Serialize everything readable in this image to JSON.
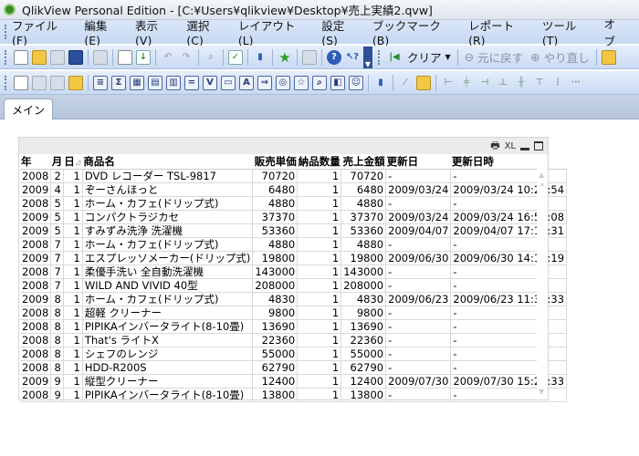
{
  "window": {
    "title": "QlikView Personal Edition - [C:¥Users¥qlikview¥Desktop¥売上実績2.qvw]"
  },
  "menu": [
    "ファイル(F)",
    "編集(E)",
    "表示(V)",
    "選択(C)",
    "レイアウト(L)",
    "設定(S)",
    "ブックマーク(B)",
    "レポート(R)",
    "ツール(T)",
    "オブ"
  ],
  "toolbar": {
    "clear": "クリア",
    "back": "元に戻す",
    "forward": "やり直し"
  },
  "tabs": [
    {
      "label": "メイン",
      "active": true
    }
  ],
  "table": {
    "caption_icons": {
      "print": "print-icon",
      "excel": "XL"
    },
    "headers": [
      "年",
      "月",
      "日",
      "商品名",
      "販売単価",
      "納品数量",
      "売上金額",
      "更新日",
      "更新日時"
    ],
    "sort_indicator": "日",
    "rows": [
      [
        "2008",
        "2",
        "1",
        "DVD レコーダー TSL-9817",
        "70720",
        "1",
        "70720",
        "-",
        "-"
      ],
      [
        "2009",
        "4",
        "1",
        "ぞーさんほっと",
        "6480",
        "1",
        "6480",
        "2009/03/24",
        "2009/03/24 10:24:54"
      ],
      [
        "2008",
        "5",
        "1",
        "ホーム・カフェ(ドリップ式)",
        "4880",
        "1",
        "4880",
        "-",
        "-"
      ],
      [
        "2009",
        "5",
        "1",
        "コンパクトラジカセ",
        "37370",
        "1",
        "37370",
        "2009/03/24",
        "2009/03/24 16:56:08"
      ],
      [
        "2009",
        "5",
        "1",
        "すみずみ洗浄 洗濯機",
        "53360",
        "1",
        "53360",
        "2009/04/07",
        "2009/04/07 17:10:31"
      ],
      [
        "2008",
        "7",
        "1",
        "ホーム・カフェ(ドリップ式)",
        "4880",
        "1",
        "4880",
        "-",
        "-"
      ],
      [
        "2009",
        "7",
        "1",
        "エスプレッソメーカー(ドリップ式)",
        "19800",
        "1",
        "19800",
        "2009/06/30",
        "2009/06/30 14:14:19"
      ],
      [
        "2008",
        "7",
        "1",
        "柔優手洗い 全自動洗濯機",
        "143000",
        "1",
        "143000",
        "-",
        "-"
      ],
      [
        "2008",
        "7",
        "1",
        "WILD AND VIVID 40型",
        "208000",
        "1",
        "208000",
        "-",
        "-"
      ],
      [
        "2009",
        "8",
        "1",
        "ホーム・カフェ(ドリップ式)",
        "4830",
        "1",
        "4830",
        "2009/06/23",
        "2009/06/23 11:33:33"
      ],
      [
        "2008",
        "8",
        "1",
        "超軽 クリーナー",
        "9800",
        "1",
        "9800",
        "-",
        "-"
      ],
      [
        "2008",
        "8",
        "1",
        "PIPIKAインバータライト(8-10畳)",
        "13690",
        "1",
        "13690",
        "-",
        "-"
      ],
      [
        "2008",
        "8",
        "1",
        "That's ライトX",
        "22360",
        "1",
        "22360",
        "-",
        "-"
      ],
      [
        "2008",
        "8",
        "1",
        "シェフのレンジ",
        "55000",
        "1",
        "55000",
        "-",
        "-"
      ],
      [
        "2008",
        "8",
        "1",
        "HDD-R200S",
        "62790",
        "1",
        "62790",
        "-",
        "-"
      ],
      [
        "2009",
        "9",
        "1",
        "縦型クリーナー",
        "12400",
        "1",
        "12400",
        "2009/07/30",
        "2009/07/30 15:24:33"
      ],
      [
        "2008",
        "9",
        "1",
        "PIPIKAインバータライト(8-10畳)",
        "13800",
        "1",
        "13800",
        "-",
        "-"
      ]
    ]
  }
}
